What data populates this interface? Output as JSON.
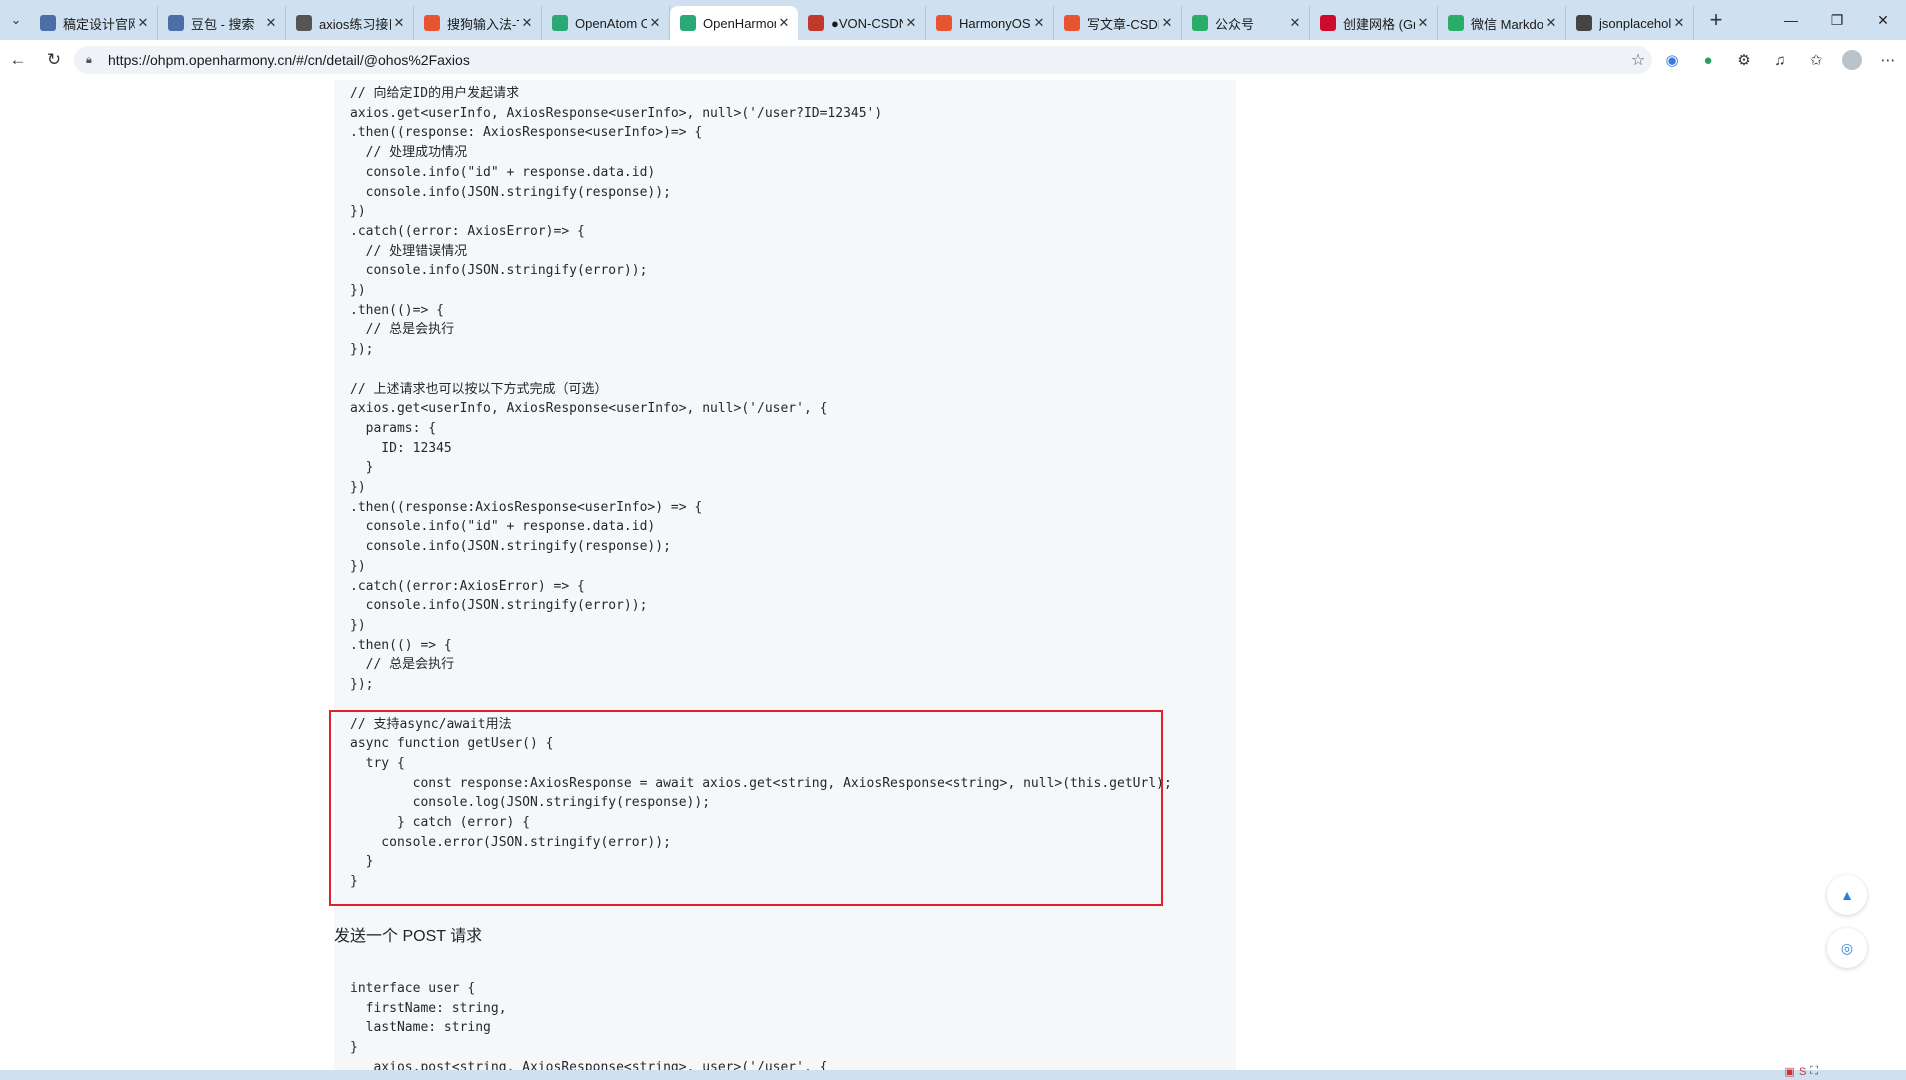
{
  "browser": {
    "tabs": [
      {
        "label": "稿定设计官网",
        "icon": "search-icon",
        "color": "#4a6fa5"
      },
      {
        "label": "豆包 - 搜索",
        "icon": "search-icon",
        "color": "#4a6fa5"
      },
      {
        "label": "axios练习接口",
        "icon": "avatar-icon",
        "color": "#555555"
      },
      {
        "label": "搜狗输入法-T",
        "icon": "sogou-icon",
        "color": "#e8542f"
      },
      {
        "label": "OpenAtom O",
        "icon": "openatom-icon",
        "color": "#2aa876"
      },
      {
        "label": "OpenHarmon",
        "icon": "ohpm-icon",
        "color": "#2aa876"
      },
      {
        "label": "●VON-CSDN",
        "icon": "csdn-icon",
        "color": "#c0392b"
      },
      {
        "label": "HarmonyOS",
        "icon": "csdn-icon",
        "color": "#e8542f"
      },
      {
        "label": "写文章-CSDN",
        "icon": "csdn-icon",
        "color": "#e8542f"
      },
      {
        "label": "公众号",
        "icon": "wechat-icon",
        "color": "#2aae67"
      },
      {
        "label": "创建网格 (Gr",
        "icon": "huawei-icon",
        "color": "#cf0a2c"
      },
      {
        "label": "微信 Markdo",
        "icon": "wechat-icon",
        "color": "#2aae67"
      },
      {
        "label": "jsonplacehol",
        "icon": "brackets-icon",
        "color": "#444444"
      }
    ],
    "active_tab_index": 5,
    "url": "https://ohpm.openharmony.cn/#/cn/detail/@ohos%2Faxios"
  },
  "page": {
    "code_block_1": "// 向给定ID的用户发起请求\naxios.get<userInfo, AxiosResponse<userInfo>, null>('/user?ID=12345')\n.then((response: AxiosResponse<userInfo>)=> {\n  // 处理成功情况\n  console.info(\"id\" + response.data.id)\n  console.info(JSON.stringify(response));\n})\n.catch((error: AxiosError)=> {\n  // 处理错误情况\n  console.info(JSON.stringify(error));\n})\n.then(()=> {\n  // 总是会执行\n});\n\n// 上述请求也可以按以下方式完成（可选）\naxios.get<userInfo, AxiosResponse<userInfo>, null>('/user', {\n  params: {\n    ID: 12345\n  }\n})\n.then((response:AxiosResponse<userInfo>) => {\n  console.info(\"id\" + response.data.id)\n  console.info(JSON.stringify(response));\n})\n.catch((error:AxiosError) => {\n  console.info(JSON.stringify(error));\n})\n.then(() => {\n  // 总是会执行\n});\n\n// 支持async/await用法\nasync function getUser() {\n  try {\n        const response:AxiosResponse = await axios.get<string, AxiosResponse<string>, null>(this.getUrl);\n        console.log(JSON.stringify(response));\n      } catch (error) {\n    console.error(JSON.stringify(error));\n  }\n}",
    "post_heading": "发送一个 POST 请求",
    "code_block_2": "interface user {\n  firstName: string,\n  lastName: string\n}\n   axios.post<string, AxiosResponse<string>, user>('/user', {"
  },
  "colors": {
    "highlight_border": "#e0202a",
    "tabstrip_bg": "#cfe0f0",
    "code_bg": "#f6f7f9",
    "float_accent": "#2a7de1"
  }
}
